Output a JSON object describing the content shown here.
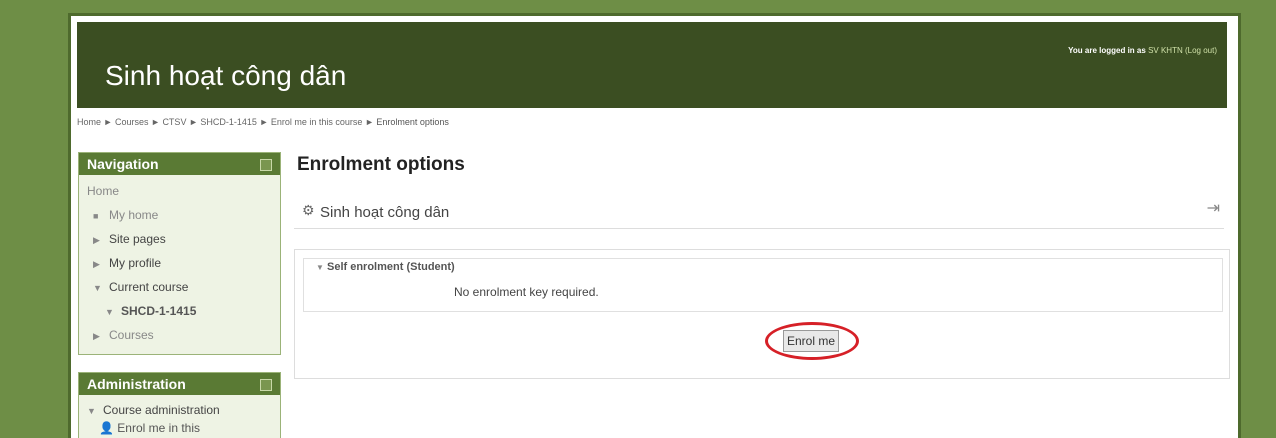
{
  "header": {
    "site_title": "Sinh hoạt công dân",
    "login_prefix": "You are logged in as",
    "user_name": "SV KHTN",
    "logout_label": "(Log out)"
  },
  "breadcrumb": {
    "items": [
      "Home",
      "Courses",
      "CTSV",
      "SHCD-1-1415",
      "Enrol me in this course",
      "Enrolment options"
    ],
    "separator": "►"
  },
  "navigation": {
    "title": "Navigation",
    "items": [
      {
        "label": "Home",
        "level": 0
      },
      {
        "label": "My home",
        "level": 1
      },
      {
        "label": "Site pages",
        "level": 1
      },
      {
        "label": "My profile",
        "level": 1
      },
      {
        "label": "Current course",
        "level": 1
      },
      {
        "label": "SHCD-1-1415",
        "level": 2
      },
      {
        "label": "Courses",
        "level": 1
      }
    ]
  },
  "administration": {
    "title": "Administration",
    "items": [
      {
        "label": "Course administration"
      },
      {
        "label": "Enrol me in this"
      }
    ]
  },
  "main": {
    "title": "Enrolment options",
    "course_name": "Sinh hoạt công dân",
    "enrol_section": {
      "legend": "Self enrolment (Student)",
      "note": "No enrolment key required.",
      "button_label": "Enrol me"
    }
  },
  "colors": {
    "background": "#6e8e46",
    "header": "#3b4e22",
    "block_header": "#5a7a34",
    "highlight": "#d62027"
  }
}
